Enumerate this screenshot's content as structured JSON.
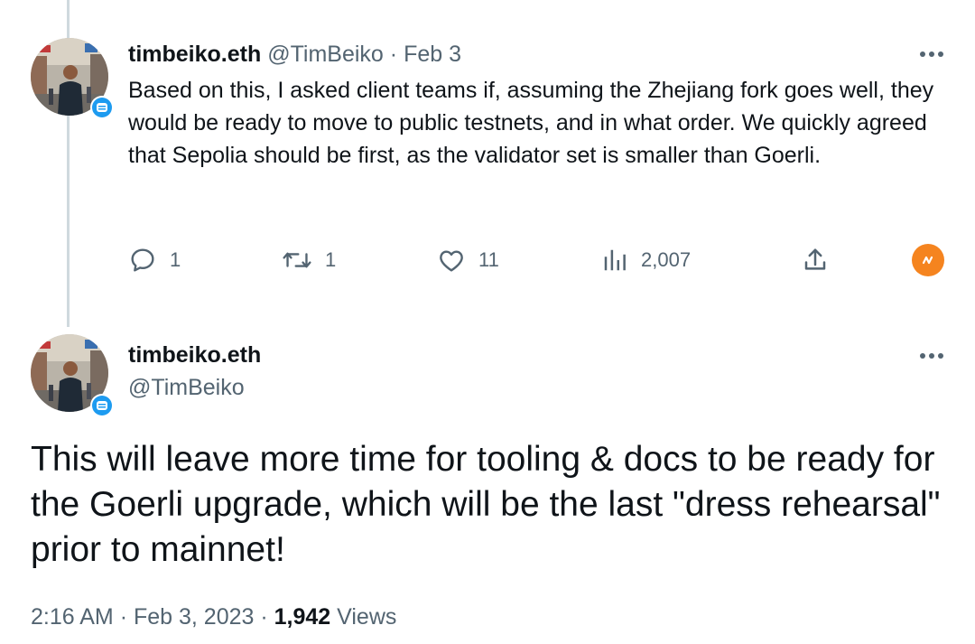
{
  "tweet1": {
    "display_name": "timbeiko.eth",
    "handle": "@TimBeiko",
    "separator": "·",
    "date": "Feb 3",
    "text": "Based on this, I asked client teams if, assuming the Zhejiang fork goes well, they would be ready to move to public testnets, and in what order. We quickly agreed that Sepolia should be first, as the validator set is smaller than Goerli.",
    "actions": {
      "replies": "1",
      "retweets": "1",
      "likes": "11",
      "views": "2,007"
    }
  },
  "tweet2": {
    "display_name": "timbeiko.eth",
    "handle": "@TimBeiko",
    "text": "This will leave more time for tooling & docs to be ready for the Goerli upgrade, which will be the last \"dress rehearsal\" prior to mainnet!",
    "meta": {
      "time": "2:16 AM",
      "separator": "·",
      "date": "Feb 3, 2023",
      "views_count": "1,942",
      "views_label": "Views"
    }
  },
  "colors": {
    "text": "#0f1419",
    "muted": "#536471",
    "accent": "#1d9bf0",
    "thread_line": "#cfd9de",
    "extension_badge": "#f5841f"
  },
  "icons": {
    "more": "more-horizontal-icon",
    "reply": "reply-icon",
    "retweet": "retweet-icon",
    "like": "heart-icon",
    "views": "analytics-icon",
    "share": "share-icon",
    "verified": "verified-org-badge-icon",
    "extension": "extension-badge-icon"
  }
}
